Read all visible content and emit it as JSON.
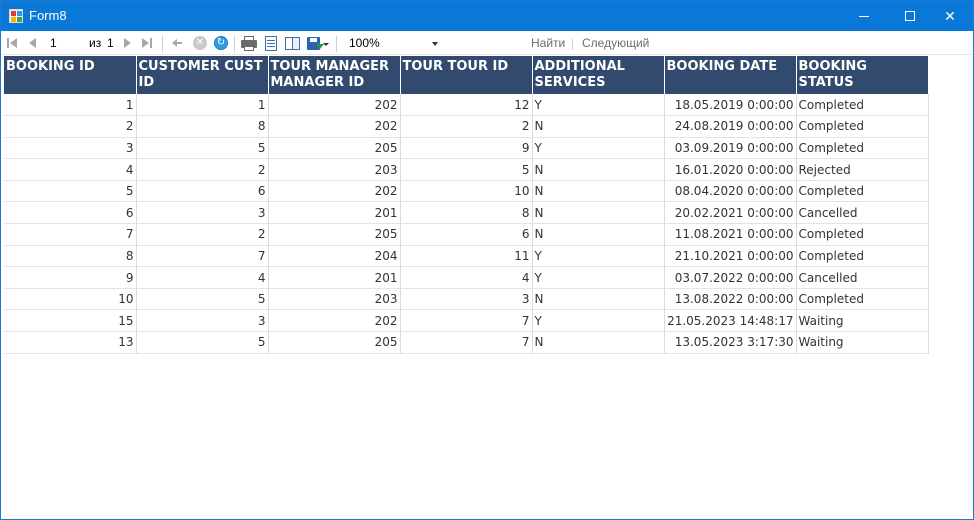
{
  "window": {
    "title": "Form8",
    "minimize_glyph": "—",
    "maximize_glyph": "☐",
    "close_glyph": "✕"
  },
  "toolbar": {
    "current_page": "1",
    "of_label": "из",
    "total_pages": "1",
    "zoom": "100%",
    "find_placeholder": "",
    "find_label": "Найти",
    "next_label": "Следующий",
    "icons": [
      "first-page-icon",
      "previous-page-icon",
      "next-page-icon",
      "last-page-icon",
      "back-icon",
      "stop-icon",
      "refresh-icon",
      "print-icon",
      "print-layout-icon",
      "page-setup-icon",
      "export-icon"
    ]
  },
  "colors": {
    "titlebar": "#0a78d7",
    "header_bg": "#324a6e",
    "header_text": "#ffffff"
  },
  "report": {
    "columns": [
      "BOOKING ID",
      "CUSTOMER CUST ID",
      "TOUR MANAGER MANAGER ID",
      "TOUR TOUR ID",
      "ADDITIONAL SERVICES",
      "BOOKING DATE",
      "BOOKING STATUS"
    ],
    "rows": [
      [
        "1",
        "1",
        "202",
        "12",
        "Y",
        "18.05.2019 0:00:00",
        "Completed"
      ],
      [
        "2",
        "8",
        "202",
        "2",
        "N",
        "24.08.2019 0:00:00",
        "Completed"
      ],
      [
        "3",
        "5",
        "205",
        "9",
        "Y",
        "03.09.2019 0:00:00",
        "Completed"
      ],
      [
        "4",
        "2",
        "203",
        "5",
        "N",
        "16.01.2020 0:00:00",
        "Rejected"
      ],
      [
        "5",
        "6",
        "202",
        "10",
        "N",
        "08.04.2020 0:00:00",
        "Completed"
      ],
      [
        "6",
        "3",
        "201",
        "8",
        "N",
        "20.02.2021 0:00:00",
        "Cancelled"
      ],
      [
        "7",
        "2",
        "205",
        "6",
        "N",
        "11.08.2021 0:00:00",
        "Completed"
      ],
      [
        "8",
        "7",
        "204",
        "11",
        "Y",
        "21.10.2021 0:00:00",
        "Completed"
      ],
      [
        "9",
        "4",
        "201",
        "4",
        "Y",
        "03.07.2022 0:00:00",
        "Cancelled"
      ],
      [
        "10",
        "5",
        "203",
        "3",
        "N",
        "13.08.2022 0:00:00",
        "Completed"
      ],
      [
        "15",
        "3",
        "202",
        "7",
        "Y",
        "21.05.2023 14:48:17",
        "Waiting"
      ],
      [
        "13",
        "5",
        "205",
        "7",
        "N",
        "13.05.2023 3:17:30",
        "Waiting"
      ]
    ]
  }
}
